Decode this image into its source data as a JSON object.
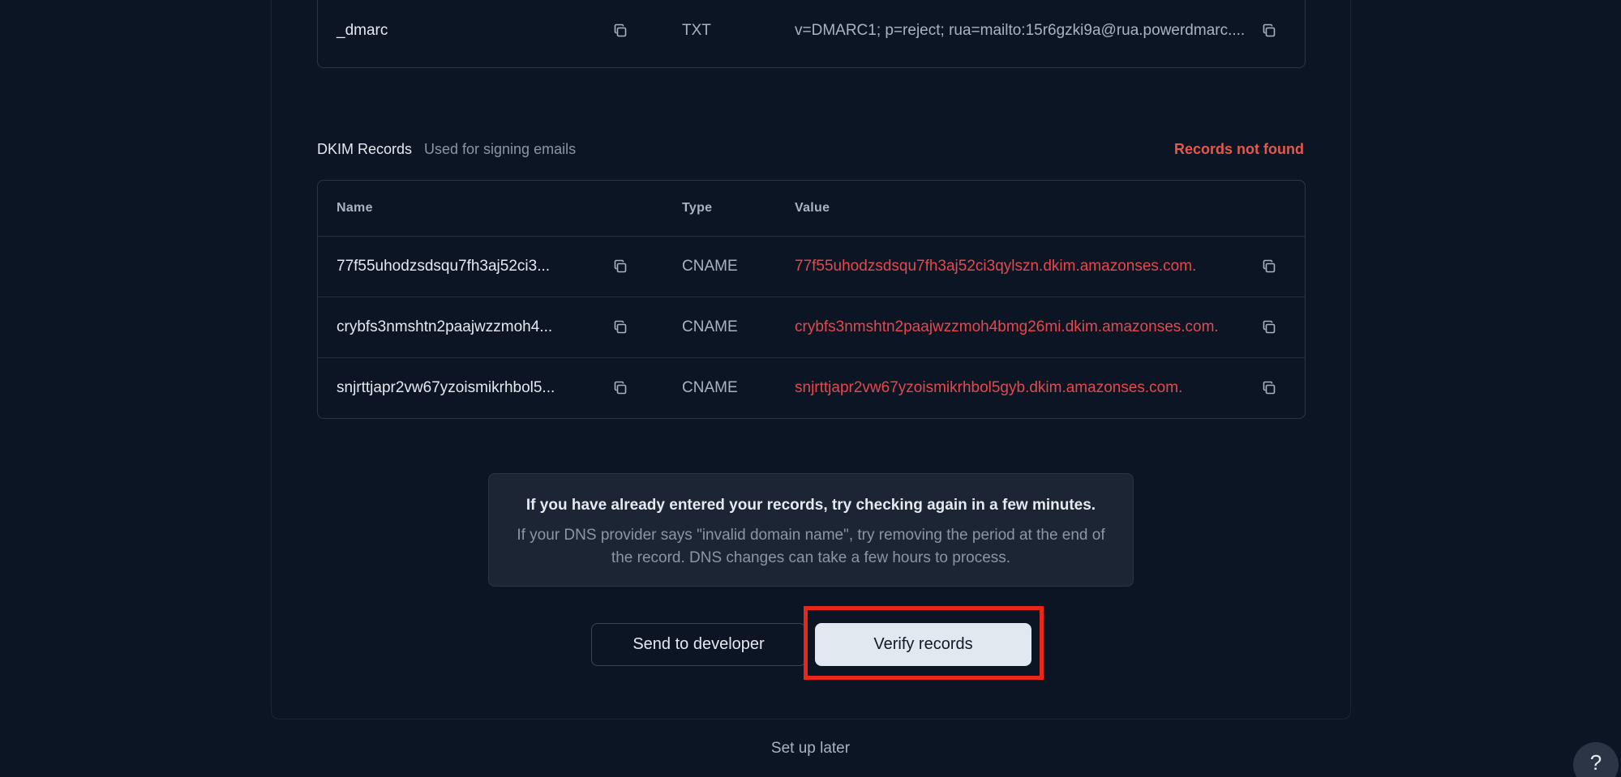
{
  "top_table": {
    "rows": [
      {
        "name": "_dmarc",
        "type": "TXT",
        "value": "v=DMARC1; p=reject; rua=mailto:15r6gzki9a@rua.powerdmarc...."
      }
    ]
  },
  "dkim": {
    "title": "DKIM Records",
    "subtitle": "Used for signing emails",
    "status": "Records not found",
    "columns": {
      "name": "Name",
      "type": "Type",
      "value": "Value"
    },
    "rows": [
      {
        "name": "77f55uhodzsdsqu7fh3aj52ci3...",
        "type": "CNAME",
        "value": "77f55uhodzsdsqu7fh3aj52ci3qylszn.dkim.amazonses.com."
      },
      {
        "name": "crybfs3nmshtn2paajwzzmoh4...",
        "type": "CNAME",
        "value": "crybfs3nmshtn2paajwzzmoh4bmg26mi.dkim.amazonses.com."
      },
      {
        "name": "snjrttjapr2vw67yzoismikrhbol5...",
        "type": "CNAME",
        "value": "snjrttjapr2vw67yzoismikrhbol5gyb.dkim.amazonses.com."
      }
    ]
  },
  "info": {
    "title": "If you have already entered your records, try checking again in a few minutes.",
    "body": "If your DNS provider says \"invalid domain name\", try removing the period at the end of the record. DNS changes can take a few hours to process."
  },
  "actions": {
    "send_to_developer": "Send to developer",
    "verify_records": "Verify records",
    "set_up_later": "Set up later",
    "help": "?"
  },
  "colors": {
    "background": "#0c1524",
    "error": "#e5484d",
    "highlight": "#e8261a"
  },
  "icons": {
    "copy": "copy-icon"
  }
}
